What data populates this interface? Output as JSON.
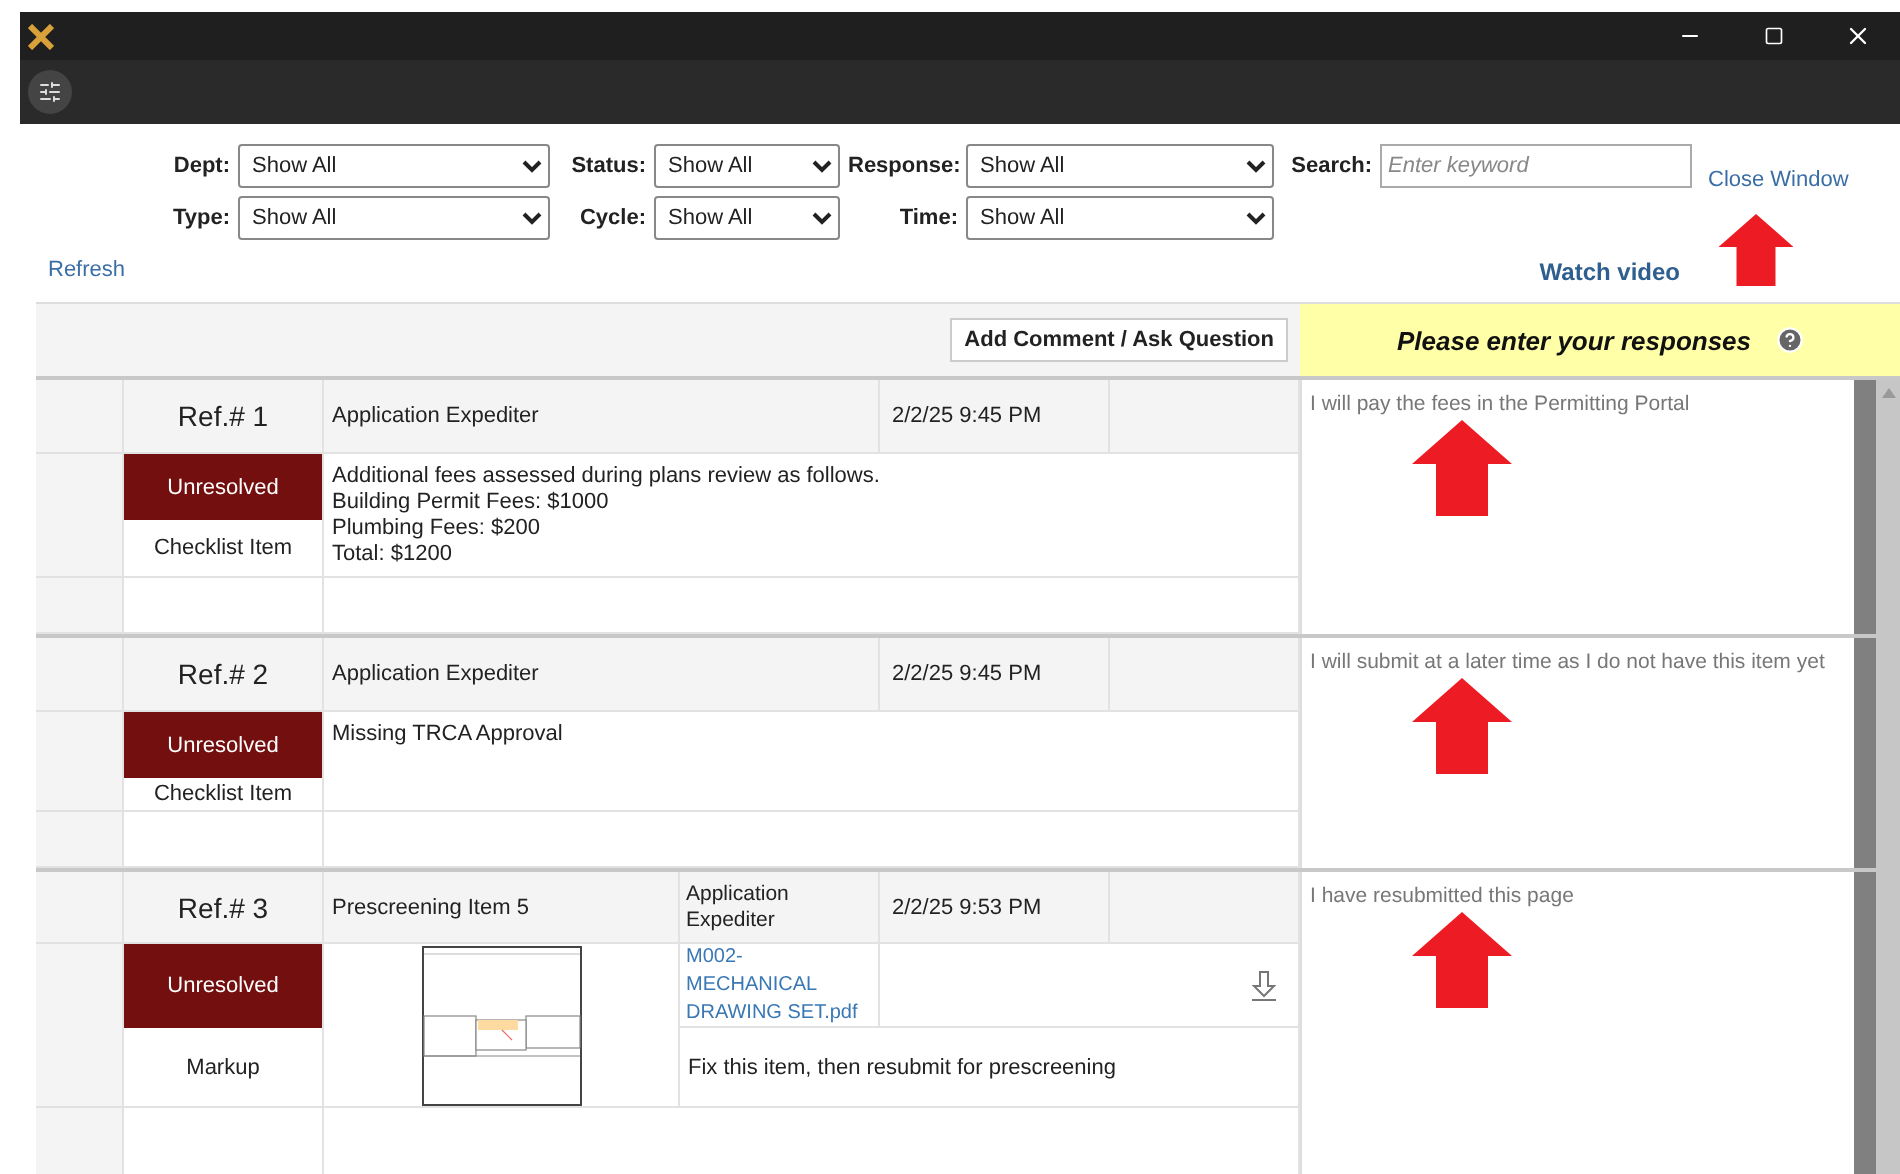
{
  "filters": [
    {
      "label": "Dept:",
      "value": "Show All"
    },
    {
      "label": "Status:",
      "value": "Show All"
    },
    {
      "label": "Response:",
      "value": "Show All"
    },
    {
      "label": "Type:",
      "value": "Show All"
    },
    {
      "label": "Cycle:",
      "value": "Show All"
    },
    {
      "label": "Time:",
      "value": "Show All"
    }
  ],
  "search": {
    "label": "Search:",
    "placeholder": "Enter keyword"
  },
  "links": {
    "close": "Close Window",
    "refresh": "Refresh",
    "video": "Watch video"
  },
  "toolbar": {
    "button": "Add Comment / Ask Question",
    "responses_title": "Please enter your responses"
  },
  "records": [
    {
      "kind": "checklist",
      "ref": "Ref.# 1",
      "status": "Unresolved",
      "type": "Checklist Item",
      "author": "Application Expediter",
      "date": "2/2/25 9:45 PM",
      "lines": [
        "Additional fees assessed during plans review as follows.",
        "Building Permit Fees: $1000",
        "Plumbing Fees: $200",
        "Total: $1200"
      ],
      "response": "I will pay the fees in the Permitting Portal"
    },
    {
      "kind": "checklist",
      "ref": "Ref.# 2",
      "status": "Unresolved",
      "type": "Checklist Item",
      "author": "Application Expediter",
      "date": "2/2/25 9:45 PM",
      "lines": [
        "Missing TRCA Approval"
      ],
      "response": "I will submit at a later time as I do not have this item yet"
    },
    {
      "kind": "markup",
      "ref": "Ref.# 3",
      "status": "Unresolved",
      "type": "Markup",
      "title": "Prescreening Item 5",
      "author": "Application Expediter",
      "date": "2/2/25 9:53 PM",
      "attachment": "M002-MECHANICAL DRAWING SET.pdf",
      "instruction": "Fix this item, then resubmit for prescreening",
      "response": "I have resubmitted this page"
    }
  ]
}
